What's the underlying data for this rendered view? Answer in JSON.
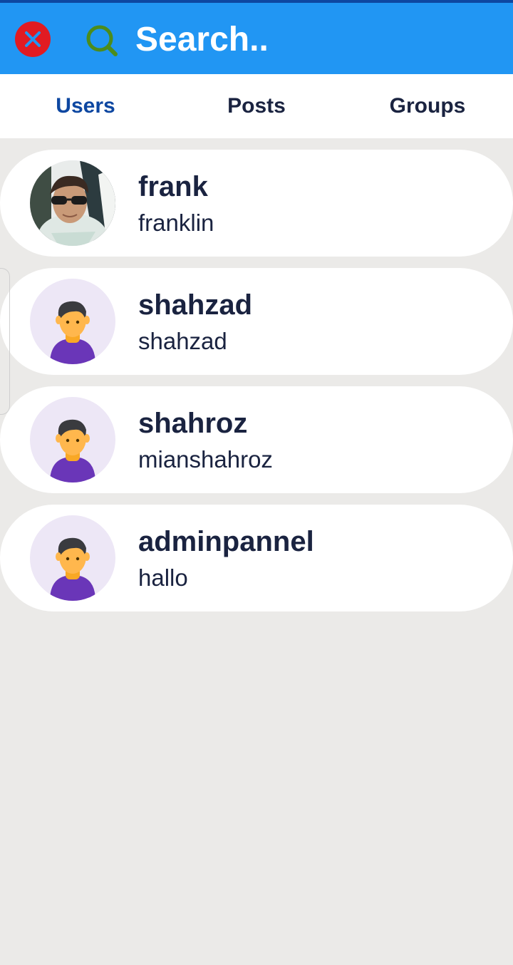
{
  "header": {
    "search_placeholder": "Search..",
    "accent": "#2196f3",
    "close_color": "#e11b22",
    "search_icon_color": "#4c8c1c"
  },
  "tabs": [
    {
      "label": "Users",
      "active": true
    },
    {
      "label": "Posts",
      "active": false
    },
    {
      "label": "Groups",
      "active": false
    }
  ],
  "users": [
    {
      "name": "frank",
      "username": "franklin",
      "avatar": "photo"
    },
    {
      "name": "shahzad",
      "username": "shahzad",
      "avatar": "default-avatar"
    },
    {
      "name": "shahroz",
      "username": "mianshahroz",
      "avatar": "default-avatar"
    },
    {
      "name": "adminpannel",
      "username": "hallo",
      "avatar": "default-avatar"
    }
  ]
}
